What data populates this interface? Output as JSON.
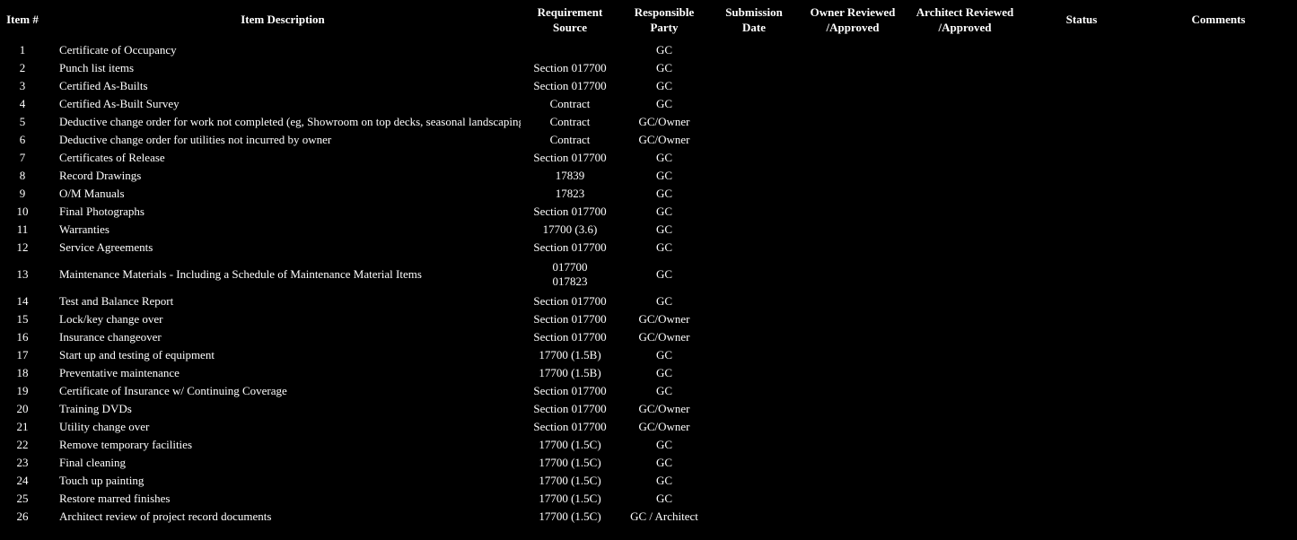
{
  "headers": {
    "itemno": "Item #",
    "desc": "Item Description",
    "reqsrc": "Requirement Source",
    "resp": "Responsible Party",
    "subdate": "Submission Date",
    "owner": "Owner Reviewed /Approved",
    "arch": "Architect Reviewed /Approved",
    "status": "Status",
    "comments": "Comments"
  },
  "rows": [
    {
      "no": "1",
      "desc": "Certificate of Occupancy",
      "reqsrc": "",
      "resp": "GC"
    },
    {
      "no": "2",
      "desc": "Punch list items",
      "reqsrc": "Section 017700",
      "resp": "GC"
    },
    {
      "no": "3",
      "desc": "Certified As-Builts",
      "reqsrc": "Section 017700",
      "resp": "GC"
    },
    {
      "no": "4",
      "desc": "Certified As-Built Survey",
      "reqsrc": "Contract",
      "resp": "GC"
    },
    {
      "no": "5",
      "desc": "Deductive change order for work not completed (eg, Showroom on top decks, seasonal landscaping, punch items, etc)",
      "reqsrc": "Contract",
      "resp": "GC/Owner"
    },
    {
      "no": "6",
      "desc": "Deductive change order for utilities not incurred by owner",
      "reqsrc": "Contract",
      "resp": "GC/Owner"
    },
    {
      "no": "7",
      "desc": "Certificates of Release",
      "reqsrc": "Section 017700",
      "resp": "GC"
    },
    {
      "no": "8",
      "desc": "Record Drawings",
      "reqsrc": "17839",
      "resp": "GC"
    },
    {
      "no": "9",
      "desc": "O/M Manuals",
      "reqsrc": "17823",
      "resp": "GC"
    },
    {
      "no": "10",
      "desc": "Final Photographs",
      "reqsrc": "Section 017700",
      "resp": "GC"
    },
    {
      "no": "11",
      "desc": "Warranties",
      "reqsrc": "17700 (3.6)",
      "resp": "GC"
    },
    {
      "no": "12",
      "desc": "Service Agreements",
      "reqsrc": "Section 017700",
      "resp": "GC"
    },
    {
      "no": "13",
      "desc": "Maintenance Materials - Including a Schedule of Maintenance Material Items",
      "reqsrc": "017700\n017823",
      "resp": "GC"
    },
    {
      "no": "14",
      "desc": "Test and Balance Report",
      "reqsrc": "Section 017700",
      "resp": "GC"
    },
    {
      "no": "15",
      "desc": "Lock/key change over",
      "reqsrc": "Section 017700",
      "resp": "GC/Owner"
    },
    {
      "no": "16",
      "desc": "Insurance changeover",
      "reqsrc": "Section 017700",
      "resp": "GC/Owner"
    },
    {
      "no": "17",
      "desc": "Start up and testing of equipment",
      "reqsrc": "17700 (1.5B)",
      "resp": "GC"
    },
    {
      "no": "18",
      "desc": "Preventative maintenance",
      "reqsrc": "17700 (1.5B)",
      "resp": "GC"
    },
    {
      "no": "19",
      "desc": "Certificate of Insurance w/ Continuing Coverage",
      "reqsrc": "Section 017700",
      "resp": "GC"
    },
    {
      "no": "20",
      "desc": "Training DVDs",
      "reqsrc": "Section 017700",
      "resp": "GC/Owner"
    },
    {
      "no": "21",
      "desc": "Utility change over",
      "reqsrc": "Section 017700",
      "resp": "GC/Owner"
    },
    {
      "no": "22",
      "desc": "Remove temporary facilities",
      "reqsrc": "17700 (1.5C)",
      "resp": "GC"
    },
    {
      "no": "23",
      "desc": "Final cleaning",
      "reqsrc": "17700 (1.5C)",
      "resp": "GC"
    },
    {
      "no": "24",
      "desc": "Touch up painting",
      "reqsrc": "17700 (1.5C)",
      "resp": "GC"
    },
    {
      "no": "25",
      "desc": "Restore marred finishes",
      "reqsrc": "17700 (1.5C)",
      "resp": "GC"
    },
    {
      "no": "26",
      "desc": "Architect review of project record documents",
      "reqsrc": "17700 (1.5C)",
      "resp": "GC / Architect"
    }
  ]
}
